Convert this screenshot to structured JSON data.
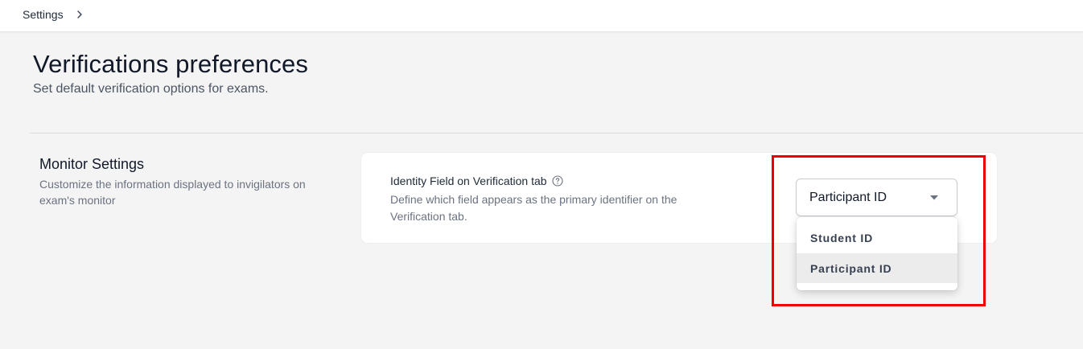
{
  "breadcrumb": {
    "item": "Settings"
  },
  "header": {
    "title": "Verifications preferences",
    "subtitle": "Set default verification options for exams."
  },
  "section": {
    "title": "Monitor Settings",
    "description": "Customize the information displayed to invigilators on exam's monitor"
  },
  "field": {
    "label": "Identity Field on Verification tab",
    "description": "Define which field appears as the primary identifier on the Verification tab.",
    "selected": "Participant ID",
    "options": [
      "Student ID",
      "Participant ID"
    ]
  },
  "colors": {
    "highlight": "#ee0000",
    "background": "#f4f4f4",
    "card": "#ffffff"
  },
  "icons": {
    "breadcrumb_separator": "chevron-right-icon",
    "help": "question-circle-icon",
    "dropdown": "caret-down-icon"
  }
}
